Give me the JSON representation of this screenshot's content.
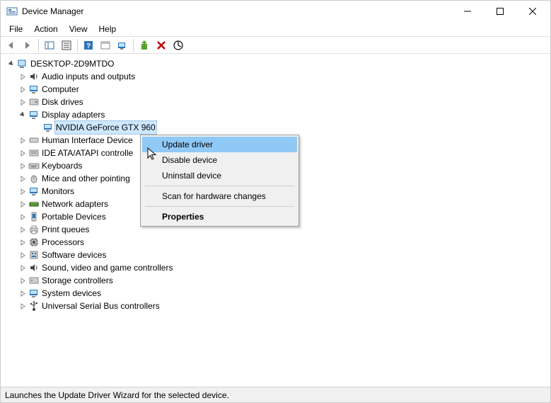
{
  "window": {
    "title": "Device Manager"
  },
  "menu": {
    "file": "File",
    "action": "Action",
    "view": "View",
    "help": "Help"
  },
  "tree": {
    "root": "DESKTOP-2D9MTDO",
    "audio": "Audio inputs and outputs",
    "computer": "Computer",
    "disk": "Disk drives",
    "display": "Display adapters",
    "gpu": "NVIDIA GeForce GTX 960",
    "hid": "Human Interface Device",
    "ide": "IDE ATA/ATAPI controlle",
    "keyboards": "Keyboards",
    "mice": "Mice and other pointing",
    "monitors": "Monitors",
    "network": "Network adapters",
    "portable": "Portable Devices",
    "print": "Print queues",
    "processors": "Processors",
    "software": "Software devices",
    "sound": "Sound, video and game controllers",
    "storage": "Storage controllers",
    "system": "System devices",
    "usb": "Universal Serial Bus controllers"
  },
  "context_menu": {
    "update": "Update driver",
    "disable": "Disable device",
    "uninstall": "Uninstall device",
    "scan": "Scan for hardware changes",
    "properties": "Properties"
  },
  "status": {
    "text": "Launches the Update Driver Wizard for the selected device."
  }
}
